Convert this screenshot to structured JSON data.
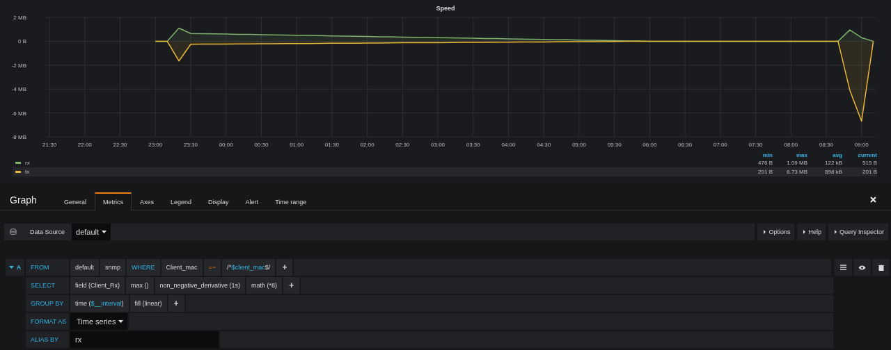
{
  "panel": {
    "title": "Speed",
    "chart_data": {
      "type": "area",
      "categories": [
        "21:30",
        null,
        null,
        "22:00",
        null,
        null,
        "22:30",
        null,
        null,
        "23:00",
        null,
        null,
        "23:30",
        null,
        null,
        "00:00",
        null,
        null,
        "00:30",
        null,
        null,
        "01:00",
        null,
        null,
        "01:30",
        null,
        null,
        "02:00",
        null,
        null,
        "02:30",
        null,
        null,
        "03:00",
        null,
        null,
        "03:30",
        null,
        null,
        "04:00",
        null,
        null,
        "04:30",
        null,
        null,
        "05:00",
        null,
        null,
        "05:30",
        null,
        null,
        "06:00",
        null,
        null,
        "06:30",
        null,
        null,
        "07:00",
        null,
        null,
        "07:30",
        null,
        null,
        "08:00",
        null,
        null,
        "08:30",
        null,
        null,
        "09:00",
        null
      ],
      "series": [
        {
          "name": "rx",
          "color": "#7eb26d",
          "values": [
            null,
            null,
            null,
            null,
            null,
            null,
            null,
            null,
            null,
            0,
            0,
            1.1,
            0.65,
            0.63,
            0.62,
            0.6,
            0.58,
            0.57,
            0.55,
            0.53,
            0.52,
            0.5,
            0.48,
            0.47,
            0.45,
            0.43,
            0.42,
            0.4,
            0.38,
            0.37,
            0.35,
            0.33,
            0.32,
            0.3,
            0.28,
            0.27,
            0.25,
            0.23,
            0.22,
            0.2,
            0.18,
            0.17,
            0.15,
            0.13,
            0.12,
            0.1,
            0.08,
            0.07,
            0.05,
            0.03,
            0.02,
            0,
            0,
            0,
            0,
            0,
            0,
            0,
            0,
            0,
            0,
            0,
            0,
            0,
            0,
            0,
            0,
            0,
            0.95,
            0.3,
            0
          ]
        },
        {
          "name": "tx",
          "color": "#eab839",
          "values": [
            null,
            null,
            null,
            null,
            null,
            null,
            null,
            null,
            null,
            0,
            0,
            -1.65,
            -0.25,
            -0.24,
            -0.24,
            -0.23,
            -0.22,
            -0.22,
            -0.21,
            -0.21,
            -0.2,
            -0.19,
            -0.19,
            -0.18,
            -0.17,
            -0.17,
            -0.16,
            -0.15,
            -0.15,
            -0.14,
            -0.13,
            -0.13,
            -0.12,
            -0.12,
            -0.11,
            -0.1,
            -0.1,
            -0.09,
            -0.08,
            -0.08,
            -0.07,
            -0.06,
            -0.06,
            -0.05,
            -0.04,
            -0.04,
            -0.03,
            -0.03,
            -0.02,
            -0.01,
            -0.01,
            0,
            0,
            0,
            0,
            0,
            0,
            0,
            0,
            0,
            0,
            0,
            0,
            0,
            0,
            0,
            0,
            0,
            -4.1,
            -6.7,
            0
          ]
        }
      ],
      "grid": true,
      "ylim": [
        -8,
        2
      ],
      "yticks": [
        {
          "value": 2,
          "label": "2 MB"
        },
        {
          "value": 0,
          "label": "0 B"
        },
        {
          "value": -2,
          "label": "-2 MB"
        },
        {
          "value": -4,
          "label": "-4 MB"
        },
        {
          "value": -6,
          "label": "-6 MB"
        },
        {
          "value": -8,
          "label": "-8 MB"
        }
      ]
    }
  },
  "legend": {
    "columns": [
      "min",
      "max",
      "avg",
      "current"
    ],
    "rows": [
      {
        "selected": false,
        "values": [
          "476 B",
          "1.09 MB",
          "122 kB",
          "515 B"
        ]
      },
      {
        "selected": true,
        "values": [
          "201 B",
          "6.73 MB",
          "898 kB",
          "201 B"
        ]
      }
    ]
  },
  "editor": {
    "title": "Graph",
    "tabs": [
      {
        "label": "General",
        "selected": false
      },
      {
        "label": "Metrics",
        "selected": true
      },
      {
        "label": "Axes",
        "selected": false
      },
      {
        "label": "Legend",
        "selected": false
      },
      {
        "label": "Display",
        "selected": false
      },
      {
        "label": "Alert",
        "selected": false
      },
      {
        "label": "Time range",
        "selected": false
      }
    ]
  },
  "data_source": {
    "label": "Data Source",
    "value": "default",
    "buttons": [
      "Options",
      "Help",
      "Query Inspector"
    ]
  },
  "query": {
    "ref": "A",
    "rows": [
      {
        "keyword": "FROM",
        "parts": [
          {
            "kind": "plain",
            "text": "default"
          },
          {
            "kind": "plain",
            "text": "snmp"
          },
          {
            "kind": "keyword",
            "text": "WHERE"
          },
          {
            "kind": "plain",
            "text": "Client_mac"
          },
          {
            "kind": "operator",
            "text": "=~"
          },
          {
            "kind": "mixed",
            "segments": [
              {
                "text": "/^",
                "var": false
              },
              {
                "text": "$client_mac",
                "var": true
              },
              {
                "text": "$/",
                "var": false
              }
            ]
          },
          {
            "kind": "add",
            "text": "+"
          }
        ]
      },
      {
        "keyword": "SELECT",
        "parts": [
          {
            "kind": "plain",
            "text": "field (Client_Rx)"
          },
          {
            "kind": "plain",
            "text": "max ()"
          },
          {
            "kind": "plain",
            "text": "non_negative_derivative (1s)"
          },
          {
            "kind": "plain",
            "text": "math (*8)"
          },
          {
            "kind": "add",
            "text": "+"
          }
        ]
      },
      {
        "keyword": "GROUP BY",
        "parts": [
          {
            "kind": "mixed",
            "segments": [
              {
                "text": "time (",
                "var": false
              },
              {
                "text": "$__interval",
                "var": true
              },
              {
                "text": ")",
                "var": false
              }
            ]
          },
          {
            "kind": "plain",
            "text": "fill (linear)"
          },
          {
            "kind": "add",
            "text": "+"
          }
        ]
      },
      {
        "keyword": "FORMAT AS",
        "parts": [
          {
            "kind": "select",
            "text": "Time series"
          }
        ]
      },
      {
        "keyword": "ALIAS BY",
        "parts": [
          {
            "kind": "input",
            "text": "rx"
          }
        ]
      }
    ]
  }
}
